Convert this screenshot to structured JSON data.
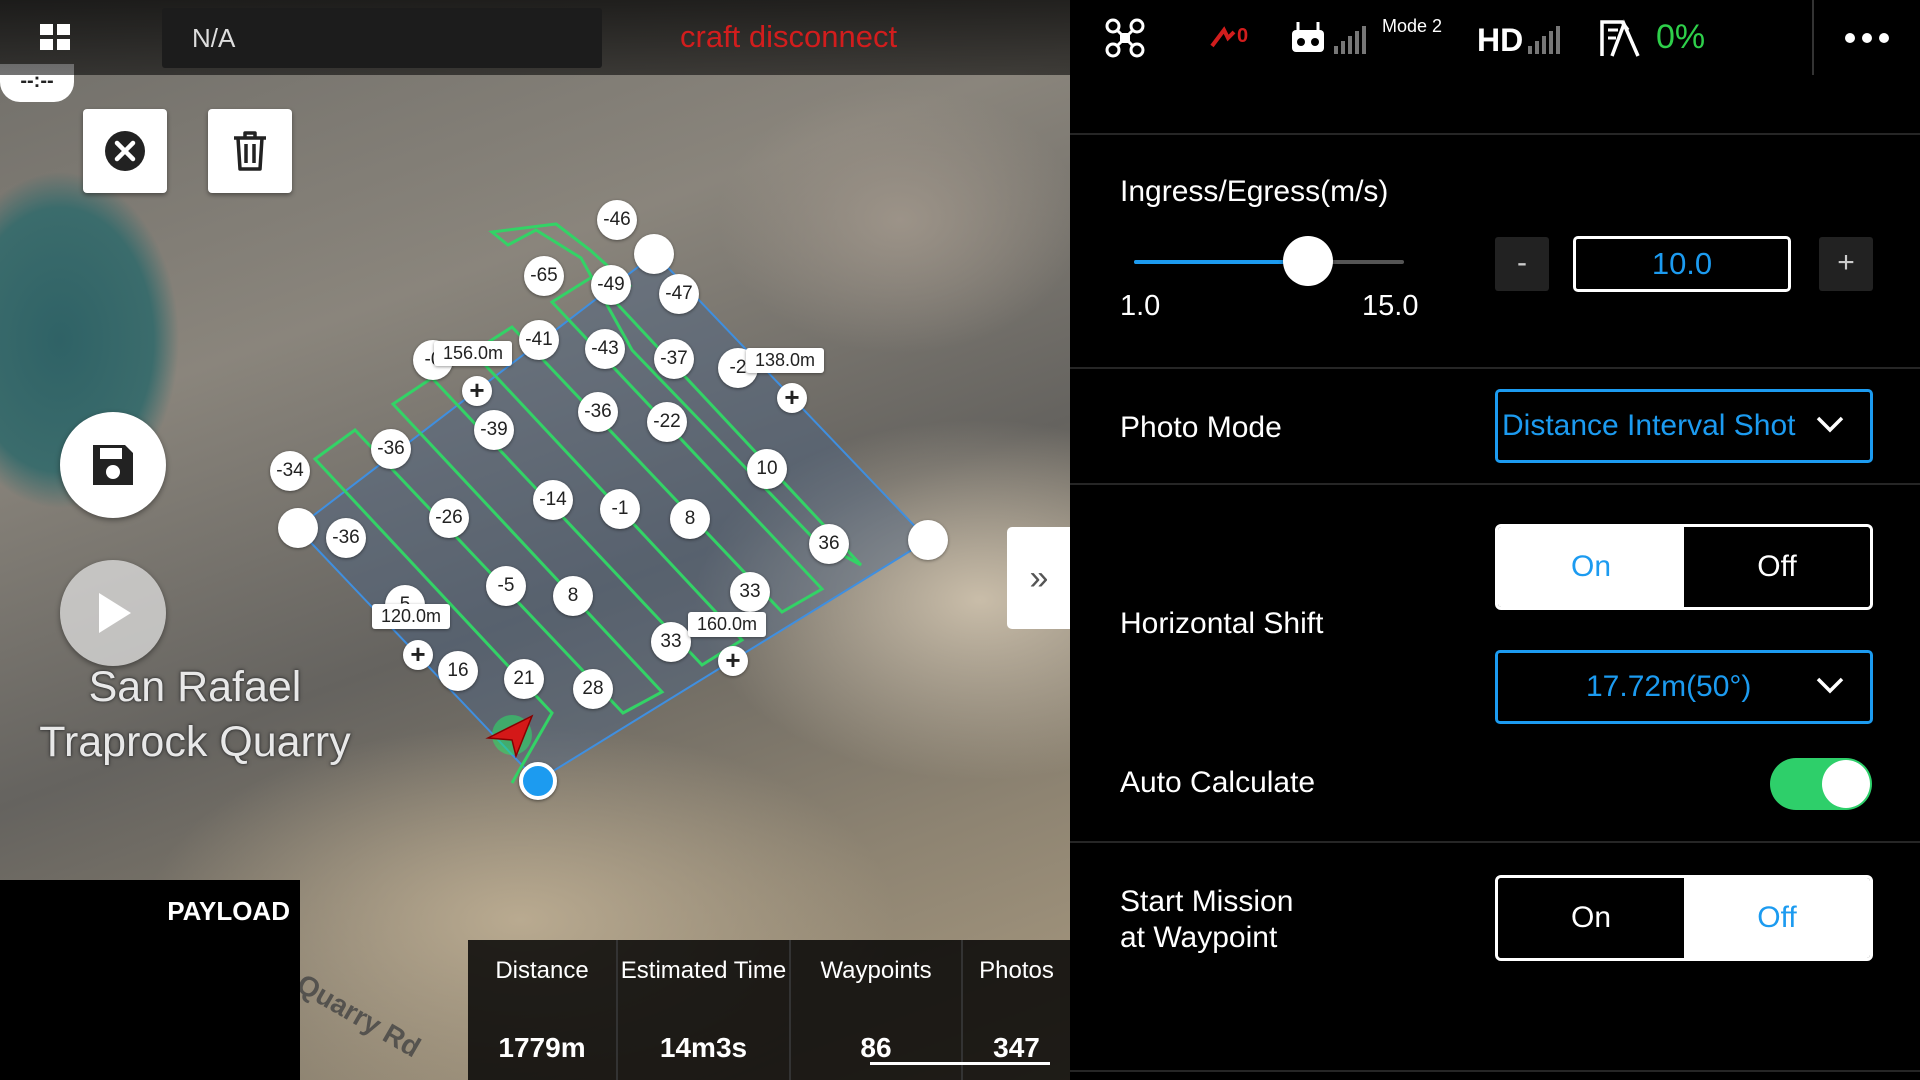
{
  "top_bar": {
    "menu_icon": "grid-icon",
    "status_text": "N/A",
    "warning_text": "craft disconnect",
    "aircraft_icon": "drone-icon",
    "signal_count": "0",
    "remote_mode": "Mode 2",
    "video_label": "HD",
    "battery_percent": "0%",
    "more_icon": "more-dots-icon",
    "colors": {
      "warning": "#d21d1d",
      "battery": "#2ecf4a"
    }
  },
  "map": {
    "timer": "--:--",
    "place_name": "San Rafael Traprock Quarry",
    "road_name": "Quarry Rd",
    "waypoints": [
      "-46",
      "-65",
      "-49",
      "-47",
      "-41",
      "-43",
      "-37",
      "-2",
      "-36",
      "-22",
      "-39",
      "-36",
      "-34",
      "-14",
      "-1",
      "8",
      "10",
      "-26",
      "-36",
      "36",
      "-5",
      "8",
      "33",
      "33",
      "5",
      "16",
      "21",
      "28",
      "-0"
    ],
    "edge_labels": [
      "156.0m",
      "138.0m",
      "120.0m",
      "160.0m"
    ],
    "buttons": {
      "close": "close-icon",
      "delete": "trash-icon",
      "save": "save-icon",
      "play": "play-icon",
      "expand": "double-chevron-right-icon"
    }
  },
  "payload": {
    "label": "PAYLOAD"
  },
  "stats": [
    {
      "label": "Distance",
      "value": "1779m"
    },
    {
      "label": "Estimated Time",
      "value": "14m3s"
    },
    {
      "label": "Waypoints",
      "value": "86"
    },
    {
      "label": "Photos",
      "value": "347"
    }
  ],
  "panel": {
    "speed": {
      "label": "Ingress/Egress(m/s)",
      "min": "1.0",
      "max": "15.0",
      "value": "10.0",
      "min_num": 1.0,
      "max_num": 15.0,
      "value_num": 10.0,
      "minus": "-",
      "plus": "+"
    },
    "photo_mode": {
      "label": "Photo Mode",
      "value": "Distance Interval Shot"
    },
    "horizontal_shift": {
      "label": "Horizontal Shift",
      "on": "On",
      "off": "Off",
      "selected": "On",
      "offset": "17.72m(50°)"
    },
    "auto_calculate": {
      "label": "Auto Calculate",
      "enabled": true
    },
    "start_mission": {
      "label_line1": "Start Mission",
      "label_line2": "at Waypoint",
      "on": "On",
      "off": "Off",
      "selected": "Off"
    },
    "colors": {
      "accent": "#1c9bf0",
      "toggle_on": "#2ecf6a"
    }
  }
}
